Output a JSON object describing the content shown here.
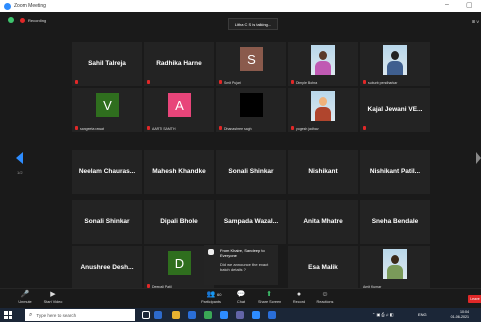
{
  "window": {
    "title": "Zoom Meeting",
    "minimize": "–",
    "maximize": "▢"
  },
  "top": {
    "recording": "Recording",
    "talking": "Litha C S is talking...",
    "view": "⊞ V"
  },
  "nav": {
    "page": "1/2"
  },
  "tiles": [
    {
      "name": "Sahil Talreja",
      "small": "",
      "avatar": ""
    },
    {
      "name": "Radhika Harne",
      "small": "",
      "avatar": ""
    },
    {
      "name": "",
      "small": "Smit Pujari",
      "avatar": "S"
    },
    {
      "name": "",
      "small": "Dimple Bohra",
      "avatar": ""
    },
    {
      "name": "",
      "small": "suburb pendharkar",
      "avatar": ""
    },
    {
      "name": "",
      "small": "sangeeta rawat",
      "avatar": "V"
    },
    {
      "name": "",
      "small": "AARTI SAMTH",
      "avatar": "A"
    },
    {
      "name": "",
      "small": "Dhanashree sagh",
      "avatar": ""
    },
    {
      "name": "",
      "small": "yogesh jadhav",
      "avatar": ""
    },
    {
      "name": "Kajal Jewani VE...",
      "small": "",
      "avatar": ""
    },
    {
      "name": "Neelam Chauras...",
      "small": "",
      "avatar": ""
    },
    {
      "name": "Mahesh Khandke",
      "small": "",
      "avatar": ""
    },
    {
      "name": "Sonali Shinkar",
      "small": "",
      "avatar": ""
    },
    {
      "name": "Nishikant",
      "small": "",
      "avatar": ""
    },
    {
      "name": "Nishikant Patil...",
      "small": "",
      "avatar": ""
    },
    {
      "name": "Sonali Shinkar",
      "small": "",
      "avatar": ""
    },
    {
      "name": "Dipali Bhole",
      "small": "",
      "avatar": ""
    },
    {
      "name": "Sampada Wazal...",
      "small": "",
      "avatar": ""
    },
    {
      "name": "Anita Mhatre",
      "small": "",
      "avatar": ""
    },
    {
      "name": "Sneha Bendale",
      "small": "",
      "avatar": ""
    },
    {
      "name": "Anushree Desh...",
      "small": "",
      "avatar": ""
    },
    {
      "name": "",
      "small": "Deepali Patil",
      "avatar": "D"
    },
    {
      "name": "",
      "small": "",
      "avatar": ""
    },
    {
      "name": "Esa Malik",
      "small": "",
      "avatar": ""
    },
    {
      "name": "",
      "small": "Amit Kumar",
      "avatar": ""
    }
  ],
  "chat": {
    "from": "From Khaire, Sandeep to Everyone",
    "message": "Did we announce the exact batch details ?"
  },
  "toolbar": {
    "unmute": "Unmute",
    "start_video": "Start Video",
    "participants": "Participants",
    "participant_count": "60",
    "chat": "Chat",
    "share_screen": "Share Screen",
    "record": "Record",
    "reactions": "Reactions",
    "leave": "Leave"
  },
  "taskbar": {
    "search_placeholder": "Type here to search",
    "lang": "ENG",
    "time": "10:04",
    "date": "01-06-2021"
  },
  "colors": {
    "avatar_v": "#2f6e1e",
    "avatar_a": "#e8457a",
    "avatar_s": "#8a5a4c",
    "avatar_d": "#2f6e1e",
    "accent": "#2d8cff"
  }
}
